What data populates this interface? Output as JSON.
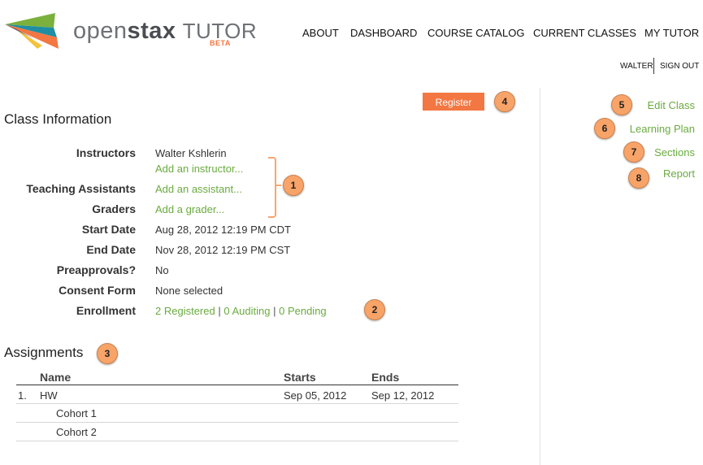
{
  "header": {
    "brand_open": "open",
    "brand_stax": "stax",
    "brand_tutor": "TUTOR",
    "brand_beta": "BETA",
    "nav": [
      "ABOUT",
      "DASHBOARD",
      "COURSE CATALOG",
      "CURRENT CLASSES",
      "MY TUTOR"
    ],
    "user_name": "WALTER",
    "sign_out": "SIGN OUT"
  },
  "register_label": "Register",
  "badges": [
    "1",
    "2",
    "3",
    "4",
    "5",
    "6",
    "7",
    "8"
  ],
  "sidebar": {
    "items": [
      "Edit Class",
      "Learning Plan",
      "Sections",
      "Report"
    ]
  },
  "class_info": {
    "title": "Class Information",
    "instructors_label": "Instructors",
    "instructor_name": "Walter Kshlerin",
    "add_instructor": "Add an instructor...",
    "tas_label": "Teaching Assistants",
    "add_assistant": "Add an assistant...",
    "graders_label": "Graders",
    "add_grader": "Add a grader...",
    "start_label": "Start Date",
    "start_value": "Aug 28, 2012 12:19 PM CDT",
    "end_label": "End Date",
    "end_value": "Nov 28, 2012 12:19 PM CST",
    "preapprovals_label": "Preapprovals?",
    "preapprovals_value": "No",
    "consent_label": "Consent Form",
    "consent_value": "None selected",
    "enrollment_label": "Enrollment",
    "registered": "2 Registered",
    "auditing": "0 Auditing",
    "pending": "0 Pending",
    "separator": "|"
  },
  "assignments": {
    "title": "Assignments",
    "columns": [
      "Name",
      "Starts",
      "Ends"
    ],
    "rows": [
      {
        "num": "1.",
        "name": "HW",
        "starts": "Sep 05, 2012",
        "ends": "Sep 12, 2012"
      }
    ],
    "cohorts": [
      "Cohort 1",
      "Cohort 2"
    ]
  },
  "colors": {
    "accent_orange": "#f37742",
    "link_green": "#6aab3f",
    "badge_fill": "#f8a368"
  }
}
